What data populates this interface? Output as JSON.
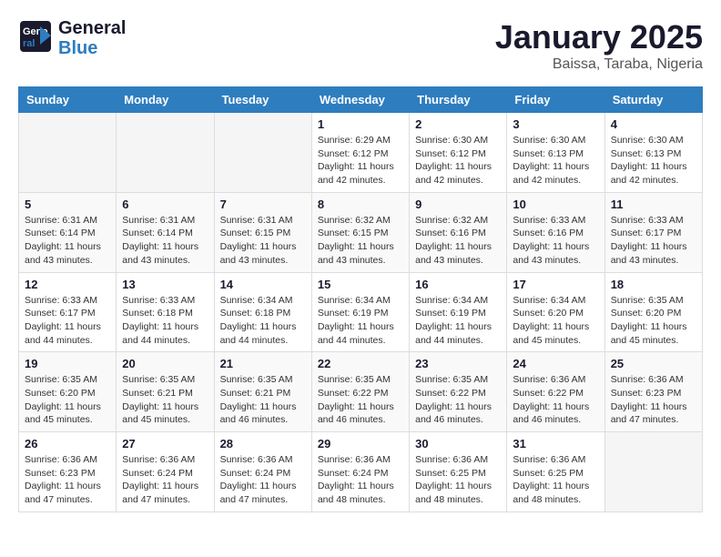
{
  "header": {
    "logo_line1a": "General",
    "logo_line1b": "",
    "logo_line2": "Blue",
    "month": "January 2025",
    "location": "Baissa, Taraba, Nigeria"
  },
  "weekdays": [
    "Sunday",
    "Monday",
    "Tuesday",
    "Wednesday",
    "Thursday",
    "Friday",
    "Saturday"
  ],
  "weeks": [
    [
      {
        "day": "",
        "info": ""
      },
      {
        "day": "",
        "info": ""
      },
      {
        "day": "",
        "info": ""
      },
      {
        "day": "1",
        "info": "Sunrise: 6:29 AM\nSunset: 6:12 PM\nDaylight: 11 hours\nand 42 minutes."
      },
      {
        "day": "2",
        "info": "Sunrise: 6:30 AM\nSunset: 6:12 PM\nDaylight: 11 hours\nand 42 minutes."
      },
      {
        "day": "3",
        "info": "Sunrise: 6:30 AM\nSunset: 6:13 PM\nDaylight: 11 hours\nand 42 minutes."
      },
      {
        "day": "4",
        "info": "Sunrise: 6:30 AM\nSunset: 6:13 PM\nDaylight: 11 hours\nand 42 minutes."
      }
    ],
    [
      {
        "day": "5",
        "info": "Sunrise: 6:31 AM\nSunset: 6:14 PM\nDaylight: 11 hours\nand 43 minutes."
      },
      {
        "day": "6",
        "info": "Sunrise: 6:31 AM\nSunset: 6:14 PM\nDaylight: 11 hours\nand 43 minutes."
      },
      {
        "day": "7",
        "info": "Sunrise: 6:31 AM\nSunset: 6:15 PM\nDaylight: 11 hours\nand 43 minutes."
      },
      {
        "day": "8",
        "info": "Sunrise: 6:32 AM\nSunset: 6:15 PM\nDaylight: 11 hours\nand 43 minutes."
      },
      {
        "day": "9",
        "info": "Sunrise: 6:32 AM\nSunset: 6:16 PM\nDaylight: 11 hours\nand 43 minutes."
      },
      {
        "day": "10",
        "info": "Sunrise: 6:33 AM\nSunset: 6:16 PM\nDaylight: 11 hours\nand 43 minutes."
      },
      {
        "day": "11",
        "info": "Sunrise: 6:33 AM\nSunset: 6:17 PM\nDaylight: 11 hours\nand 43 minutes."
      }
    ],
    [
      {
        "day": "12",
        "info": "Sunrise: 6:33 AM\nSunset: 6:17 PM\nDaylight: 11 hours\nand 44 minutes."
      },
      {
        "day": "13",
        "info": "Sunrise: 6:33 AM\nSunset: 6:18 PM\nDaylight: 11 hours\nand 44 minutes."
      },
      {
        "day": "14",
        "info": "Sunrise: 6:34 AM\nSunset: 6:18 PM\nDaylight: 11 hours\nand 44 minutes."
      },
      {
        "day": "15",
        "info": "Sunrise: 6:34 AM\nSunset: 6:19 PM\nDaylight: 11 hours\nand 44 minutes."
      },
      {
        "day": "16",
        "info": "Sunrise: 6:34 AM\nSunset: 6:19 PM\nDaylight: 11 hours\nand 44 minutes."
      },
      {
        "day": "17",
        "info": "Sunrise: 6:34 AM\nSunset: 6:20 PM\nDaylight: 11 hours\nand 45 minutes."
      },
      {
        "day": "18",
        "info": "Sunrise: 6:35 AM\nSunset: 6:20 PM\nDaylight: 11 hours\nand 45 minutes."
      }
    ],
    [
      {
        "day": "19",
        "info": "Sunrise: 6:35 AM\nSunset: 6:20 PM\nDaylight: 11 hours\nand 45 minutes."
      },
      {
        "day": "20",
        "info": "Sunrise: 6:35 AM\nSunset: 6:21 PM\nDaylight: 11 hours\nand 45 minutes."
      },
      {
        "day": "21",
        "info": "Sunrise: 6:35 AM\nSunset: 6:21 PM\nDaylight: 11 hours\nand 46 minutes."
      },
      {
        "day": "22",
        "info": "Sunrise: 6:35 AM\nSunset: 6:22 PM\nDaylight: 11 hours\nand 46 minutes."
      },
      {
        "day": "23",
        "info": "Sunrise: 6:35 AM\nSunset: 6:22 PM\nDaylight: 11 hours\nand 46 minutes."
      },
      {
        "day": "24",
        "info": "Sunrise: 6:36 AM\nSunset: 6:22 PM\nDaylight: 11 hours\nand 46 minutes."
      },
      {
        "day": "25",
        "info": "Sunrise: 6:36 AM\nSunset: 6:23 PM\nDaylight: 11 hours\nand 47 minutes."
      }
    ],
    [
      {
        "day": "26",
        "info": "Sunrise: 6:36 AM\nSunset: 6:23 PM\nDaylight: 11 hours\nand 47 minutes."
      },
      {
        "day": "27",
        "info": "Sunrise: 6:36 AM\nSunset: 6:24 PM\nDaylight: 11 hours\nand 47 minutes."
      },
      {
        "day": "28",
        "info": "Sunrise: 6:36 AM\nSunset: 6:24 PM\nDaylight: 11 hours\nand 47 minutes."
      },
      {
        "day": "29",
        "info": "Sunrise: 6:36 AM\nSunset: 6:24 PM\nDaylight: 11 hours\nand 48 minutes."
      },
      {
        "day": "30",
        "info": "Sunrise: 6:36 AM\nSunset: 6:25 PM\nDaylight: 11 hours\nand 48 minutes."
      },
      {
        "day": "31",
        "info": "Sunrise: 6:36 AM\nSunset: 6:25 PM\nDaylight: 11 hours\nand 48 minutes."
      },
      {
        "day": "",
        "info": ""
      }
    ]
  ]
}
